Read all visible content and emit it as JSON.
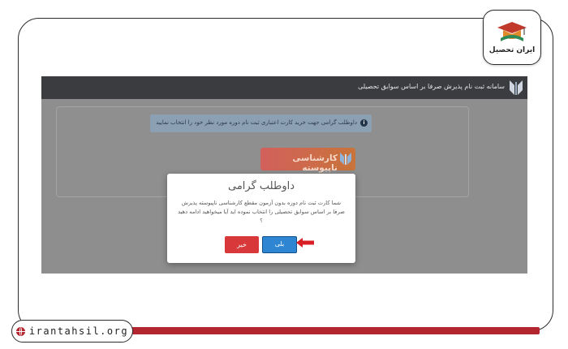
{
  "brand": {
    "logo_text": "ایران تحصیل",
    "website": "irantahsil.org"
  },
  "app_header": {
    "title": "سامانه ثبت نام پذیرش صرفا بر اساس سوابق تحصیلی"
  },
  "info_alert": {
    "text": "داوطلب گرامی جهت خرید کارت اعتباری ثبت نام دوره مورد نظر خود را انتخاب نمایید"
  },
  "course_button": {
    "label": "کارشناسی ناپیوسته"
  },
  "modal": {
    "title": "داوطلب گرامی",
    "message": "شما کارت ثبت نام دوره بدون آزمون مقطع کارشناسی ناپیوسته پذیرش صرفا بر اساس سوابق تحصیلی را انتخاب نموده اید آیا میخواهید ادامه دهید ؟",
    "confirm_label": "بلی",
    "cancel_label": "خیر"
  },
  "colors": {
    "accent_red": "#b3262f",
    "confirm_blue": "#2e85d2",
    "cancel_red": "#d9383a",
    "header_dark": "#3a3c40"
  }
}
